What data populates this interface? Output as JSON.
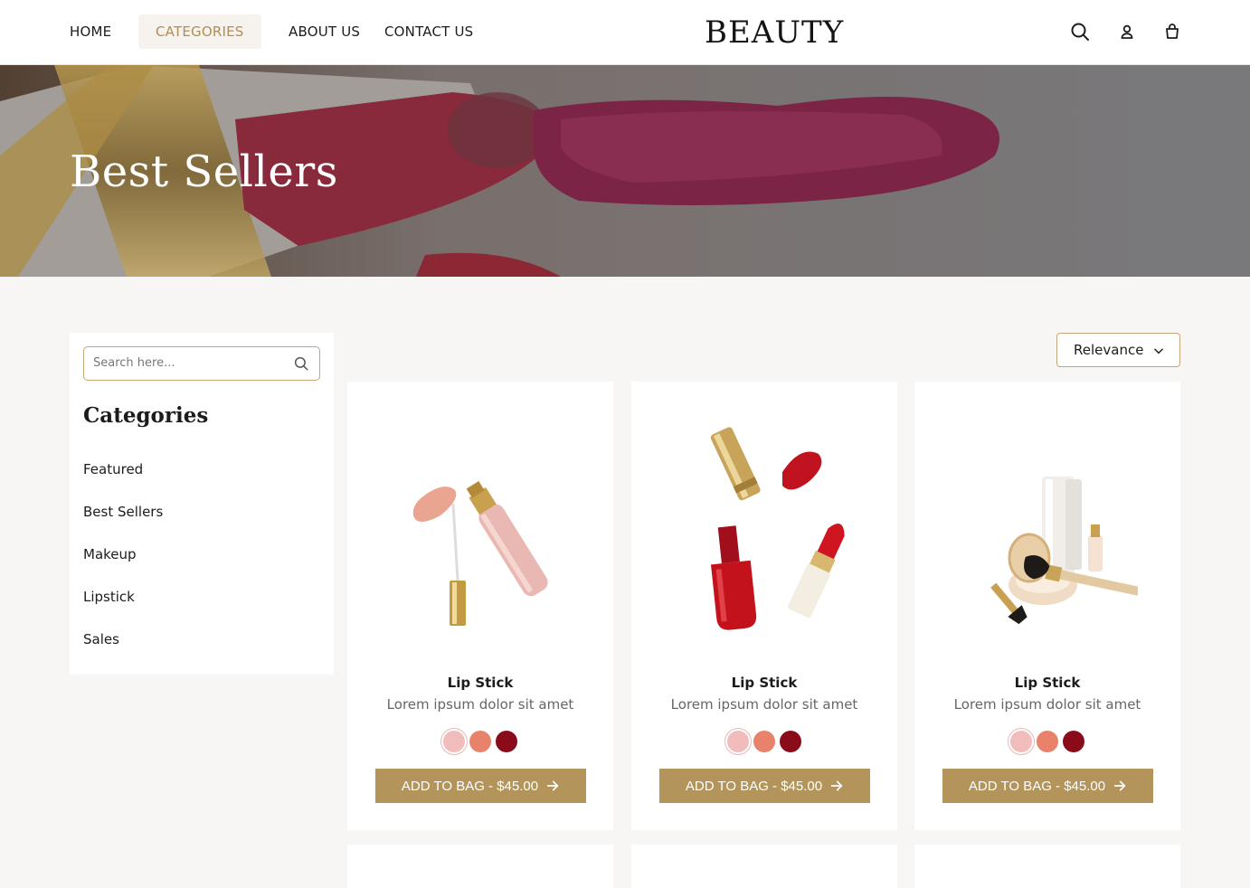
{
  "nav": {
    "home": "HOME",
    "categories": "CATEGORIES",
    "about": "ABOUT US",
    "contact": "CONTACT US",
    "logo": "BEAUTY",
    "icons": [
      "search-icon",
      "user-icon",
      "shopping-bag-icon"
    ]
  },
  "hero": {
    "title": "Best Sellers"
  },
  "sidebar": {
    "search_placeholder": "Search here...",
    "categories_title": "Categories",
    "items": [
      "Featured",
      "Best Sellers",
      "Makeup",
      "Lipstick",
      "Sales"
    ]
  },
  "sort": {
    "label": "Relevance"
  },
  "products": [
    {
      "name": "Lip Stick",
      "desc": "Lorem ipsum dolor sit amet",
      "button": "ADD TO BAG - $45.00",
      "swatches": [
        "#f1bcbc",
        "#e8826a",
        "#8a0c1a"
      ],
      "selected_swatch": 0
    },
    {
      "name": "Lip Stick",
      "desc": "Lorem ipsum dolor sit amet",
      "button": "ADD TO BAG - $45.00",
      "swatches": [
        "#f1bcbc",
        "#e8826a",
        "#8a0c1a"
      ],
      "selected_swatch": 0
    },
    {
      "name": "Lip Stick",
      "desc": "Lorem ipsum dolor sit amet",
      "button": "ADD TO BAG - $45.00",
      "swatches": [
        "#f1bcbc",
        "#e8826a",
        "#8a0c1a"
      ],
      "selected_swatch": 0
    }
  ],
  "colors": {
    "accent": "#b08d57",
    "button": "#b3955c",
    "background": "#f8f6f4"
  }
}
